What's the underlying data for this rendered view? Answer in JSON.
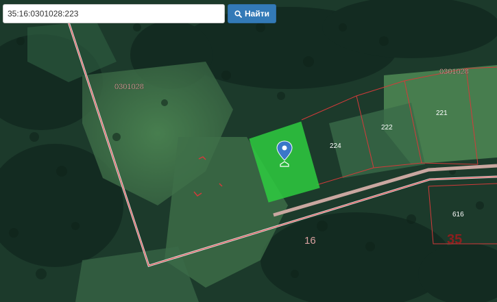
{
  "search": {
    "value": "35:16:0301028:223",
    "button_label": "Найти"
  },
  "map": {
    "quarter_labels": [
      "0301028",
      "0301028"
    ],
    "parcel_labels": [
      "224",
      "222",
      "221",
      "616"
    ],
    "region_labels": [
      "16",
      "35"
    ],
    "selected_parcel_color": "#2ecc40",
    "boundary_color": "#d43a3a",
    "district_boundary_color": "#e8e0e0",
    "marker_color": "#3a78c9"
  }
}
